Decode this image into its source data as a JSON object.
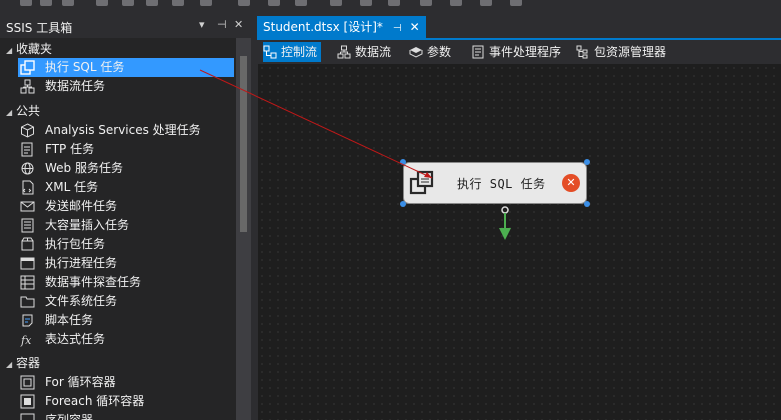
{
  "toolbox": {
    "title": "SSIS 工具箱",
    "header_buttons": {
      "dropdown": "▾",
      "pin": "⊣",
      "close": "✕"
    },
    "groups": [
      {
        "label": "收藏夹",
        "items": [
          {
            "label": "执行 SQL 任务",
            "icon": "sql-task-icon",
            "selected": true
          },
          {
            "label": "数据流任务",
            "icon": "dataflow-task-icon"
          }
        ]
      },
      {
        "label": "公共",
        "items": [
          {
            "label": "Analysis Services 处理任务",
            "icon": "analysis-services-icon"
          },
          {
            "label": "FTP 任务",
            "icon": "ftp-icon"
          },
          {
            "label": "Web 服务任务",
            "icon": "web-service-icon"
          },
          {
            "label": "XML 任务",
            "icon": "xml-icon"
          },
          {
            "label": "发送邮件任务",
            "icon": "mail-icon"
          },
          {
            "label": "大容量插入任务",
            "icon": "bulk-insert-icon"
          },
          {
            "label": "执行包任务",
            "icon": "execute-package-icon"
          },
          {
            "label": "执行进程任务",
            "icon": "execute-process-icon"
          },
          {
            "label": "数据事件探查任务",
            "icon": "data-profiling-icon"
          },
          {
            "label": "文件系统任务",
            "icon": "file-system-icon"
          },
          {
            "label": "脚本任务",
            "icon": "script-icon"
          },
          {
            "label": "表达式任务",
            "icon": "expression-icon"
          }
        ]
      },
      {
        "label": "容器",
        "items": [
          {
            "label": "For 循环容器",
            "icon": "for-loop-icon"
          },
          {
            "label": "Foreach 循环容器",
            "icon": "foreach-loop-icon"
          },
          {
            "label": "序列容器",
            "icon": "sequence-container-icon"
          }
        ]
      }
    ]
  },
  "document": {
    "tab_label": "Student.dtsx [设计]*",
    "tab_pin": "⊣",
    "tab_close": "✕",
    "designer_tabs": [
      {
        "label": "控制流",
        "icon": "control-flow-icon",
        "active": true
      },
      {
        "label": "数据流",
        "icon": "data-flow-icon"
      },
      {
        "label": "参数",
        "icon": "parameters-icon"
      },
      {
        "label": "事件处理程序",
        "icon": "event-handlers-icon"
      },
      {
        "label": "包资源管理器",
        "icon": "package-explorer-icon"
      }
    ],
    "task": {
      "label": "执行 SQL 任务",
      "status": "error",
      "status_symbol": "✕"
    }
  },
  "colors": {
    "accent": "#007acc",
    "selection": "#3399ff",
    "drag_line": "#c01818",
    "error": "#e44d26",
    "connector": "#4caf50"
  }
}
